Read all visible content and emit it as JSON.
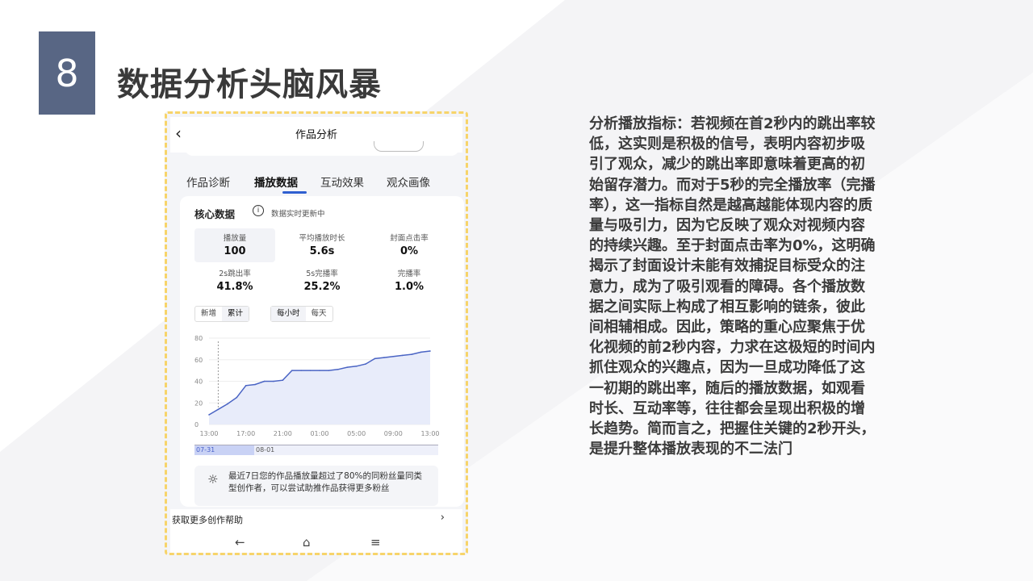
{
  "slide": {
    "number": "8",
    "title": "数据分析头脑风暴",
    "analysis_text": "分析播放指标：若视频在首2秒内的跳出率较低，这实则是积极的信号，表明内容初步吸引了观众，减少的跳出率即意味着更高的初始留存潜力。而对于5秒的完全播放率（完播率），这一指标自然是越高越能体现内容的质量与吸引力，因为它反映了观众对视频内容的持续兴趣。至于封面点击率为0%，这明确揭示了封面设计未能有效捕捉目标受众的注意力，成为了吸引观看的障碍。各个播放数据之间实际上构成了相互影响的链条，彼此间相辅相成。因此，策略的重心应聚焦于优化视频的前2秒内容，力求在这极短的时间内抓住观众的兴趣点，因为一旦成功降低了这一初期的跳出率，随后的播放数据，如观看时长、互动率等，往往都会呈现出积极的增长趋势。简而言之，把握住关键的2秒开头，是提升整体播放表现的不二法门",
    "colors": {
      "number_box": "#586684",
      "frame_dash": "#f7d46a",
      "accent": "#2f5fd0"
    }
  },
  "phone": {
    "header_title": "作品分析",
    "tabs": [
      {
        "label": "作品诊断",
        "active": false
      },
      {
        "label": "播放数据",
        "active": true
      },
      {
        "label": "互动效果",
        "active": false
      },
      {
        "label": "观众画像",
        "active": false
      }
    ],
    "core": {
      "title": "核心数据",
      "note": "数据实时更新中",
      "metrics": [
        {
          "label": "播放量",
          "value": "100"
        },
        {
          "label": "平均播放时长",
          "value": "5.6s"
        },
        {
          "label": "封面点击率",
          "value": "0%"
        },
        {
          "label": "2s跳出率",
          "value": "41.8%"
        },
        {
          "label": "5s完播率",
          "value": "25.2%"
        },
        {
          "label": "完播率",
          "value": "1.0%"
        }
      ]
    },
    "toggles": {
      "group1": [
        "新增",
        "累计"
      ],
      "group1_selected": "累计",
      "group2": [
        "每小时",
        "每天"
      ],
      "group2_selected": "每小时"
    },
    "range_labels": [
      "07-31",
      "08-01"
    ],
    "tip": "最近7日您的作品播放量超过了80%的同粉丝量同类型创作者，可以尝试助推作品获得更多粉丝",
    "help": "获取更多创作帮助",
    "nav_icons": [
      "back-nav-icon",
      "home-nav-icon",
      "menu-nav-icon"
    ]
  },
  "chart_data": {
    "type": "area",
    "x": [
      "13:00",
      "14:00",
      "15:00",
      "16:00",
      "17:00",
      "18:00",
      "19:00",
      "20:00",
      "21:00",
      "22:00",
      "23:00",
      "00:00",
      "01:00",
      "02:00",
      "03:00",
      "04:00",
      "05:00",
      "06:00",
      "07:00",
      "08:00",
      "09:00",
      "10:00",
      "11:00",
      "12:00",
      "13:00"
    ],
    "x_ticks": [
      "13:00",
      "17:00",
      "21:00",
      "01:00",
      "05:00",
      "09:00",
      "13:00"
    ],
    "values": [
      9,
      14,
      19,
      25,
      36,
      37,
      40,
      40,
      41,
      50,
      50,
      50,
      50,
      50,
      51,
      53,
      54,
      56,
      61,
      62,
      63,
      64,
      65,
      67,
      68
    ],
    "ylim": [
      0,
      80
    ],
    "yticks": [
      0,
      20,
      40,
      60,
      80
    ],
    "series_color": "#4a64c4",
    "fill_color": "#e8ecfa",
    "grid": true
  }
}
